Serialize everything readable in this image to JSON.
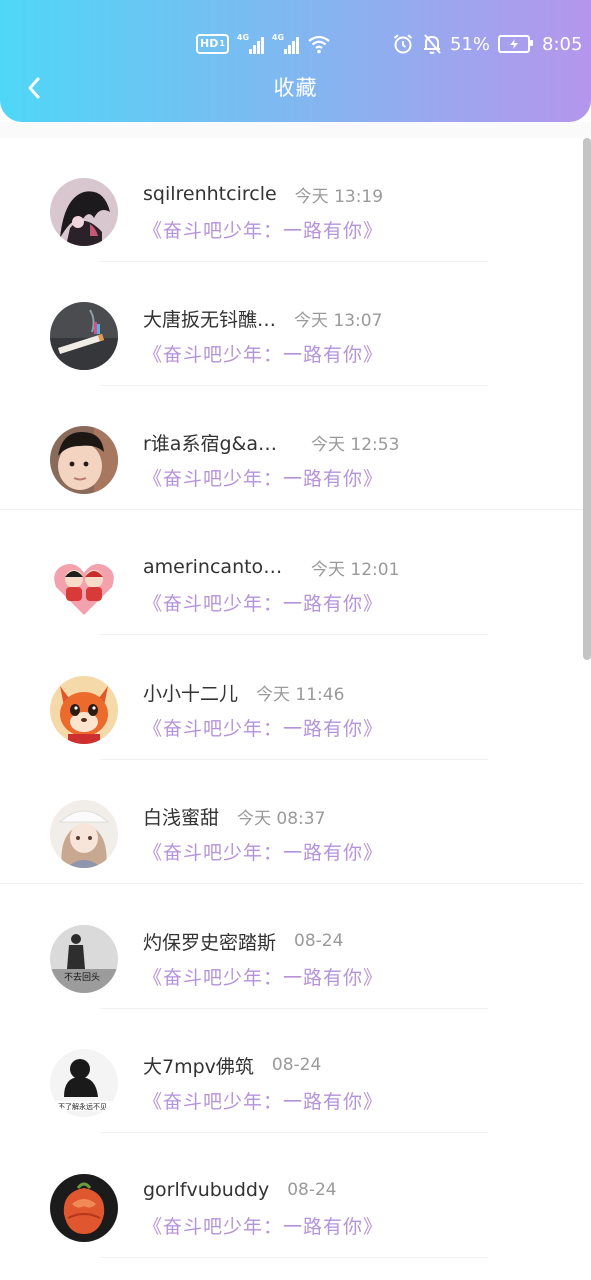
{
  "status_bar": {
    "hd_label": "HD",
    "hd_sub": "1",
    "net1_label": "4G",
    "net2_label": "4G",
    "battery_percent": "51%",
    "time": "8:05",
    "icons": [
      "hd-icon",
      "signal-4g-icon",
      "signal-4g-icon",
      "wifi-icon",
      "alarm-icon",
      "mute-bell-icon",
      "battery-charging-icon"
    ]
  },
  "header": {
    "title": "收藏",
    "back_icon": "chevron-left-icon",
    "gradient": [
      "#4fd7f7",
      "#b596ec"
    ]
  },
  "colors": {
    "accent": "#b593db",
    "time": "#9a9a9a",
    "name": "#333333"
  },
  "items": [
    {
      "name": "sqilrenhtcircle",
      "time": "今天 13:19",
      "work": "《奋斗吧少年：一路有你》",
      "avatar": "avatar-anime-dark"
    },
    {
      "name": "大唐扳无钭醮…",
      "time": "今天 13:07",
      "work": "《奋斗吧少年：一路有你》",
      "avatar": "avatar-cigarette"
    },
    {
      "name": "r谁a系宿g&am…",
      "time": "今天 12:53",
      "work": "《奋斗吧少年：一路有你》",
      "avatar": "avatar-child"
    },
    {
      "name": "amerincantouri…",
      "time": "今天 12:01",
      "work": "《奋斗吧少年：一路有你》",
      "avatar": "avatar-couple-heart"
    },
    {
      "name": "小小十二儿",
      "time": "今天 11:46",
      "work": "《奋斗吧少年：一路有你》",
      "avatar": "avatar-fox"
    },
    {
      "name": "白浅蜜甜",
      "time": "今天 08:37",
      "work": "《奋斗吧少年：一路有你》",
      "avatar": "avatar-anime-girl"
    },
    {
      "name": "灼保罗史密踏斯",
      "time": "08-24",
      "work": "《奋斗吧少年：一路有你》",
      "avatar": "avatar-bw-man",
      "avatar_text": "不去回头"
    },
    {
      "name": "大7mpv佛筑",
      "time": "08-24",
      "work": "《奋斗吧少年：一路有你》",
      "avatar": "avatar-bw-text",
      "avatar_text": "不了解永远不见"
    },
    {
      "name": "gorlfvubuddy",
      "time": "08-24",
      "work": "《奋斗吧少年：一路有你》",
      "avatar": "avatar-rose"
    }
  ]
}
